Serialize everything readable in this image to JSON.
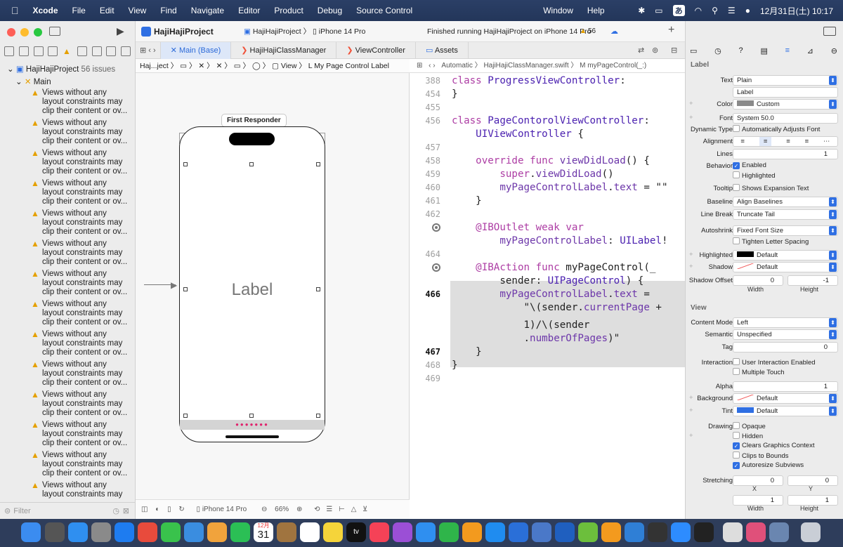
{
  "menubar": {
    "app": "Xcode",
    "items": [
      "File",
      "Edit",
      "View",
      "Find",
      "Navigate",
      "Editor",
      "Product",
      "Debug",
      "Source Control",
      "Window",
      "Help"
    ],
    "input_method": "あ",
    "datetime": "12月31日(土) 10:17"
  },
  "toolbar": {
    "project": "HajiHajiProject",
    "scheme": "HajiHajiProject",
    "device": "iPhone 14 Pro",
    "status": "Finished running HajiHajiProject on iPhone 14 Pro",
    "warnings": "56"
  },
  "tabs": [
    "Main (Base)",
    "HajiHajiClassManager",
    "ViewController",
    "Assets"
  ],
  "navigator": {
    "root": "HajiHajiProject",
    "root_count": "56 issues",
    "group": "Main",
    "issue_lines": [
      "Views without any",
      "layout constraints may",
      "clip their content or ov..."
    ],
    "issue_count": 14,
    "filter_placeholder": "Filter"
  },
  "canvas": {
    "jump_bar": "Haj...ject 〉 ▭ 〉 ✕ 〉 ✕ 〉 ▭ 〉 ◯ 〉 ▢ View 〉 L  My Page Control Label",
    "first_responder": "First Responder",
    "label": "Label",
    "device": "iPhone 14 Pro",
    "zoom": "66%"
  },
  "code": {
    "jump_bar": "Automatic 〉 HajiHajiClassManager.swift 〉 M myPageControl(_:)",
    "lines": [
      {
        "n": "388",
        "t": "class ProgressViewController:"
      },
      {
        "n": "454",
        "t": "}"
      },
      {
        "n": "455",
        "t": ""
      },
      {
        "n": "456",
        "t": "class PageContorolViewController:"
      },
      {
        "n": "",
        "t": "    UIViewController {"
      },
      {
        "n": "457",
        "t": ""
      },
      {
        "n": "458",
        "t": "    override func viewDidLoad() {"
      },
      {
        "n": "459",
        "t": "        super.viewDidLoad()"
      },
      {
        "n": "460",
        "t": "        myPageControlLabel.text = \"\""
      },
      {
        "n": "461",
        "t": "    }"
      },
      {
        "n": "462",
        "t": ""
      },
      {
        "n": "",
        "t": "    @IBOutlet weak var"
      },
      {
        "n": "",
        "t": "        myPageControlLabel: UILabel!"
      },
      {
        "n": "464",
        "t": ""
      },
      {
        "n": "",
        "t": "    @IBAction func myPageControl(_"
      },
      {
        "n": "",
        "t": "        sender: UIPageControl) {"
      },
      {
        "n": "466",
        "t": "        myPageControlLabel.text ="
      },
      {
        "n": "",
        "t": "            \"\\(sender.currentPage +"
      },
      {
        "n": "",
        "t": "            1)/\\(sender"
      },
      {
        "n": "",
        "t": "            .numberOfPages)\""
      },
      {
        "n": "467",
        "t": "    }"
      },
      {
        "n": "468",
        "t": "}"
      },
      {
        "n": "469",
        "t": ""
      }
    ]
  },
  "inspector": {
    "label_section": "Label",
    "text_type": "Plain",
    "text_value": "Label",
    "color": "Custom",
    "font": "System 50.0",
    "dynamic_type": "Automatically Adjusts Font",
    "lines": "1",
    "behavior_enabled": "Enabled",
    "behavior_highlighted": "Highlighted",
    "tooltip": "Shows Expansion Text",
    "baseline": "Align Baselines",
    "line_break": "Truncate Tail",
    "autoshrink": "Fixed Font Size",
    "tighten": "Tighten Letter Spacing",
    "highlighted": "Default",
    "shadow": "Default",
    "shadow_w": "0",
    "shadow_h": "-1",
    "view_section": "View",
    "content_mode": "Left",
    "semantic": "Unspecified",
    "tag": "0",
    "ui_enabled": "User Interaction Enabled",
    "multi_touch": "Multiple Touch",
    "alpha": "1",
    "background": "Default",
    "tint": "Default",
    "opaque": "Opaque",
    "hidden": "Hidden",
    "clears": "Clears Graphics Context",
    "clips": "Clips to Bounds",
    "autoresize": "Autoresize Subviews",
    "stretch_x": "0",
    "stretch_y": "0",
    "stretch_w": "1",
    "stretch_h": "1",
    "labels": {
      "text": "Text",
      "color": "Color",
      "font": "Font",
      "dynamic_type": "Dynamic Type",
      "alignment": "Alignment",
      "lines": "Lines",
      "behavior": "Behavior",
      "tooltip": "Tooltip",
      "baseline": "Baseline",
      "line_break": "Line Break",
      "autoshrink": "Autoshrink",
      "highlighted": "Highlighted",
      "shadow": "Shadow",
      "shadow_offset": "Shadow Offset",
      "width": "Width",
      "height": "Height",
      "content_mode": "Content Mode",
      "semantic": "Semantic",
      "tag": "Tag",
      "interaction": "Interaction",
      "alpha": "Alpha",
      "background": "Background",
      "tint": "Tint",
      "drawing": "Drawing",
      "stretching": "Stretching",
      "x": "X",
      "y": "Y"
    }
  },
  "dock": {
    "calendar_month": "12月",
    "calendar_day": "31",
    "tv": "tv"
  },
  "colors": {
    "accent": "#2f6fe3",
    "warning": "#e5a000",
    "keyword": "#ad3da4",
    "page_dots": "#e0226c"
  }
}
